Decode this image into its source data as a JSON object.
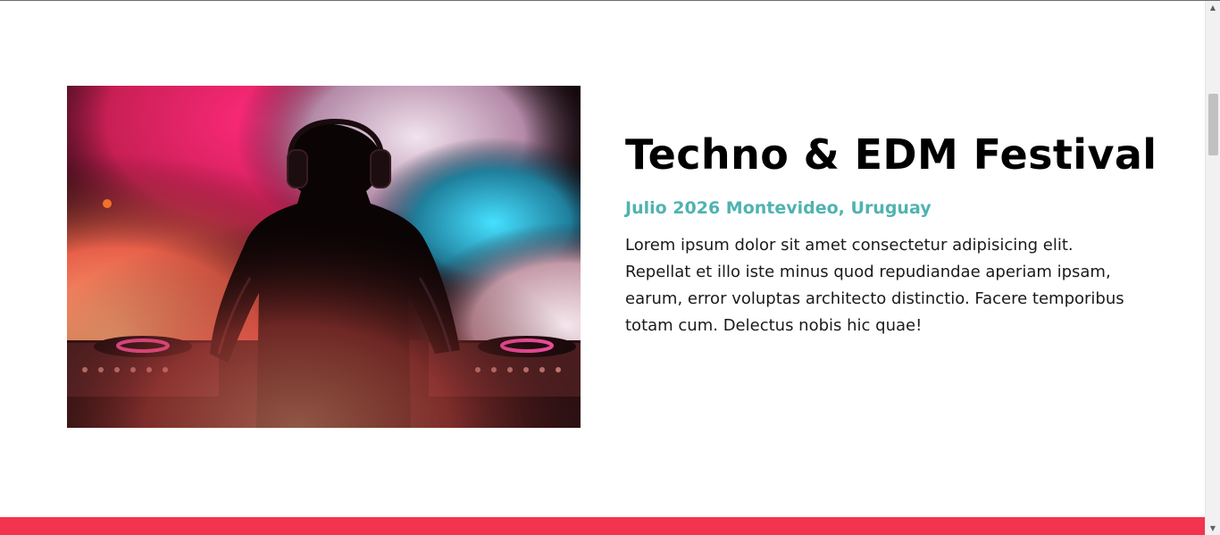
{
  "event": {
    "title": "Techno & EDM Festival",
    "subtitle": "Julio 2026 Montevideo, Uruguay",
    "description": "Lorem ipsum dolor sit amet consectetur adipisicing elit. Repellat et illo iste minus quod repudiandae aperiam ipsam, earum, error voluptas architecto distinctio. Facere temporibus totam cum. Delectus nobis hic quae!"
  },
  "colors": {
    "subtitle": "#4fb3b0",
    "footer_band": "#f2344f",
    "title": "#000000"
  },
  "scrollbar": {
    "up_icon": "▲",
    "down_icon": "▼"
  }
}
